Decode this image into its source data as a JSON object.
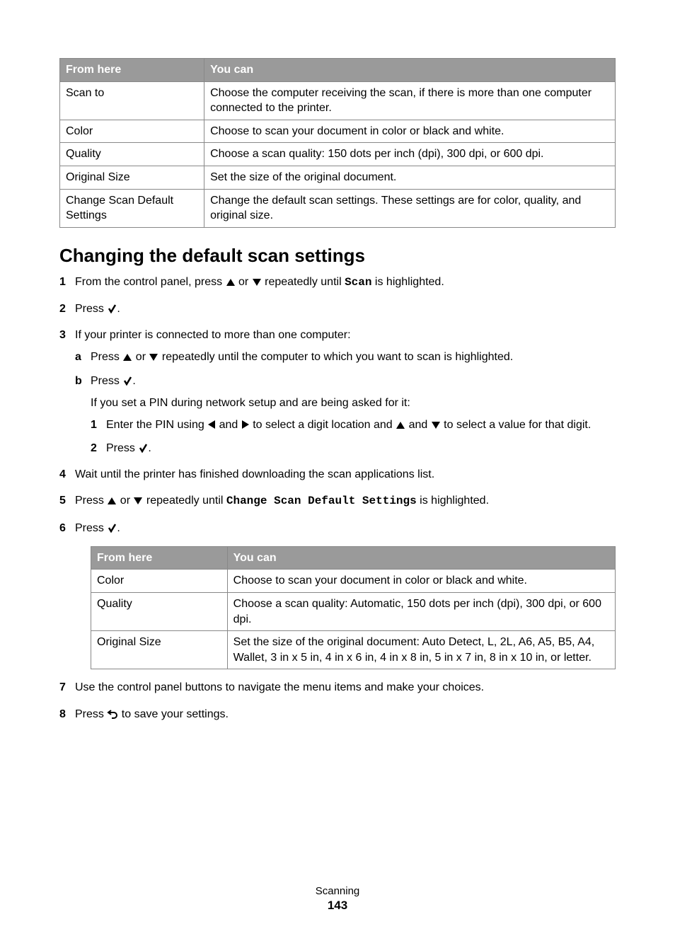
{
  "table1": {
    "headers": {
      "from": "From here",
      "you": "You can"
    },
    "rows": [
      {
        "from": "Scan to",
        "you": "Choose the computer receiving the scan, if there is more than one computer connected to the printer."
      },
      {
        "from": "Color",
        "you": "Choose to scan your document in color or black and white."
      },
      {
        "from": "Quality",
        "you": "Choose a scan quality: 150 dots per inch (dpi), 300 dpi, or 600 dpi."
      },
      {
        "from": "Original Size",
        "you": "Set the size of the original document."
      },
      {
        "from": "Change Scan Default Settings",
        "you": "Change the default scan settings. These settings are for color, quality, and original size."
      }
    ]
  },
  "heading": "Changing the default scan settings",
  "steps": {
    "s1a": "From the control panel, press ",
    "s1b": " or ",
    "s1c": " repeatedly until ",
    "s1d": "Scan",
    "s1e": " is highlighted.",
    "s2a": "Press ",
    "s2b": ".",
    "s3": "If your printer is connected to more than one computer:",
    "s3_a_1": "Press ",
    "s3_a_2": " or ",
    "s3_a_3": " repeatedly until the computer to which you want to scan is highlighted.",
    "s3_b_1": "Press ",
    "s3_b_2": ".",
    "s3_pin": "If you set a PIN during network setup and are being asked for it:",
    "s3_pin1_a": "Enter the PIN using ",
    "s3_pin1_b": " and ",
    "s3_pin1_c": " to select a digit location and ",
    "s3_pin1_d": " and ",
    "s3_pin1_e": " to select a value for that digit.",
    "s3_pin2_a": "Press ",
    "s3_pin2_b": ".",
    "s4": "Wait until the printer has finished downloading the scan applications list.",
    "s5a": "Press ",
    "s5b": " or ",
    "s5c": " repeatedly until ",
    "s5d": "Change Scan Default Settings",
    "s5e": " is highlighted.",
    "s6a": "Press ",
    "s6b": ".",
    "s7": "Use the control panel buttons to navigate the menu items and make your choices.",
    "s8a": "Press ",
    "s8b": " to save your settings."
  },
  "nums": {
    "n1": "1",
    "n2": "2",
    "n3": "3",
    "n4": "4",
    "n5": "5",
    "n6": "6",
    "n7": "7",
    "n8": "8",
    "a": "a",
    "b": "b"
  },
  "table2": {
    "headers": {
      "from": "From here",
      "you": "You can"
    },
    "rows": [
      {
        "from": "Color",
        "you": "Choose to scan your document in color or black and white."
      },
      {
        "from": "Quality",
        "you": "Choose a scan quality: Automatic, 150 dots per inch (dpi), 300 dpi, or 600 dpi."
      },
      {
        "from": "Original Size",
        "you": "Set the size of the original document: Auto Detect, L, 2L, A6, A5, B5, A4, Wallet, 3 in x 5 in, 4 in x 6 in, 4 in x 8 in, 5 in x 7 in, 8 in x 10 in, or letter."
      }
    ]
  },
  "footer": {
    "section": "Scanning",
    "page": "143"
  }
}
